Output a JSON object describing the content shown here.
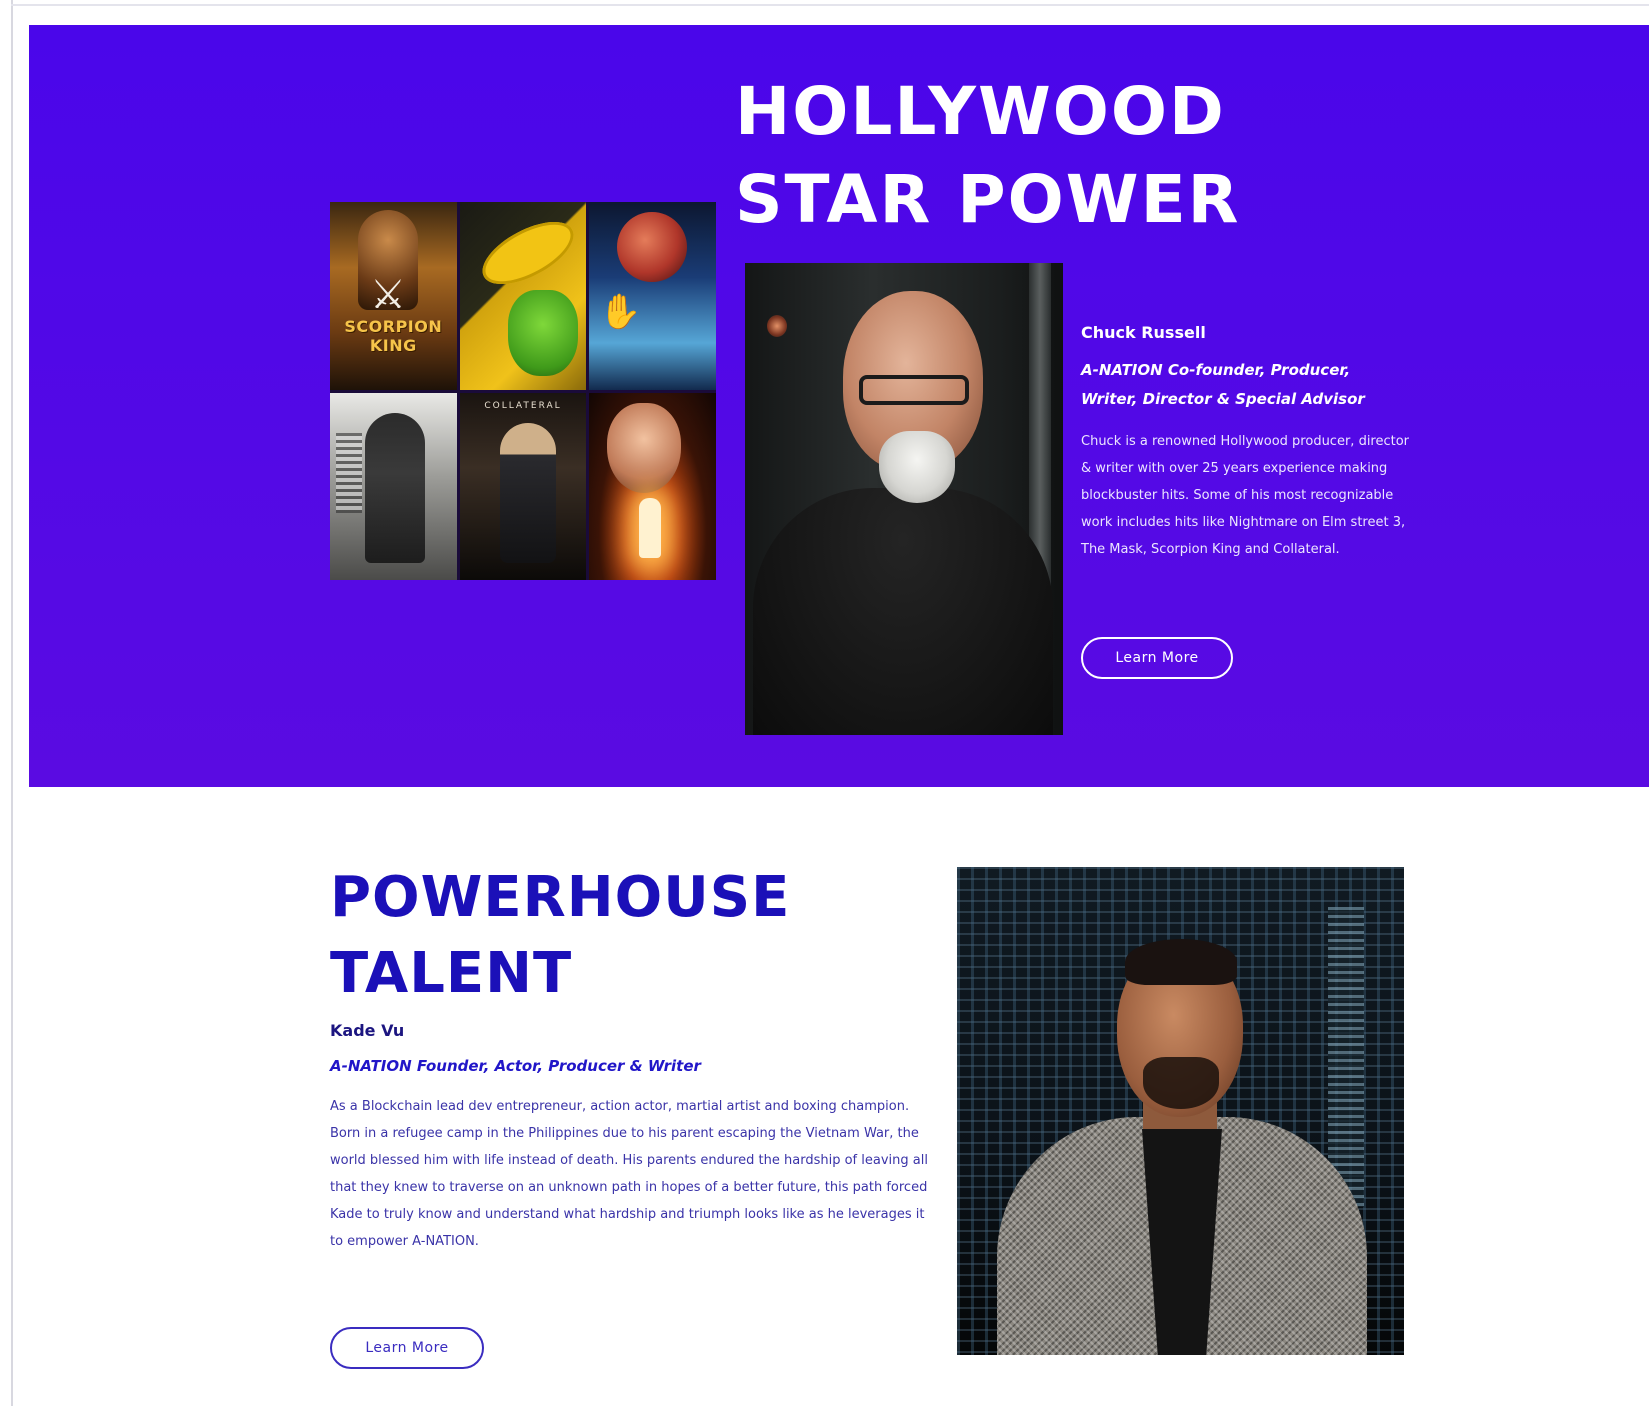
{
  "hero": {
    "title_line1": "HOLLYWOOD",
    "title_line2": "STAR POWER",
    "background_color": "#5309e6",
    "posters": [
      {
        "title": "SCORPION KING"
      },
      {
        "title": ""
      },
      {
        "title": ""
      },
      {
        "title": ""
      },
      {
        "title": "COLLATERAL"
      },
      {
        "title": ""
      }
    ],
    "person": {
      "name": "Chuck Russell",
      "role": "A-NATION Co-founder, Producer, Writer, Director & Special Advisor",
      "description": "Chuck is a renowned Hollywood producer, director & writer with over 25 years experience making blockbuster hits. Some of his most recognizable work includes hits like Nightmare on Elm street 3, The Mask, Scorpion King and Collateral.",
      "button_label": "Learn More"
    }
  },
  "powerhouse": {
    "title_line1": "POWERHOUSE",
    "title_line2": "TALENT",
    "accent_color": "#1b10b8",
    "person": {
      "name": "Kade Vu",
      "role": "A-NATION Founder, Actor, Producer & Writer",
      "description": "As a Blockchain lead dev entrepreneur, action actor, martial artist and boxing champion.  Born in a refugee camp in the Philippines due to his parent escaping the Vietnam War, the world blessed him with life instead of death. His parents endured the hardship of leaving all that they knew to traverse on an unknown path in hopes of a better future, this path forced Kade to truly know and understand what hardship and triumph looks like as he leverages it to empower A-NATION.",
      "button_label": "Learn More"
    }
  }
}
